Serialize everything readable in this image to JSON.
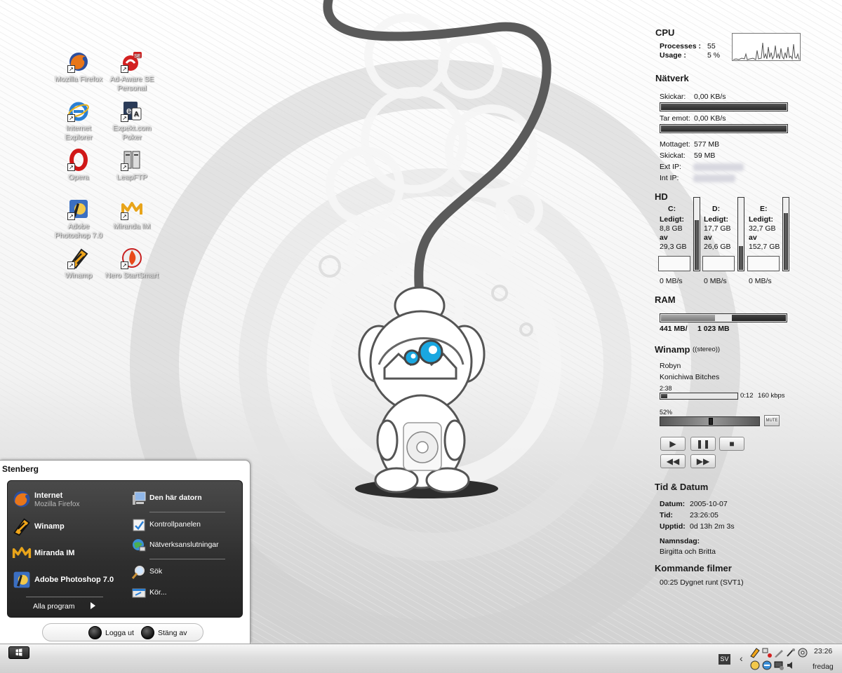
{
  "desktop": {
    "icons": [
      {
        "label": "Mozilla Firefox",
        "icon": "firefox-icon"
      },
      {
        "label": "Ad-Aware SE Personal",
        "icon": "adaware-icon"
      },
      {
        "label": "Internet Explorer",
        "icon": "internet-explorer-icon"
      },
      {
        "label": "Expekt.com Poker",
        "icon": "expekt-poker-icon"
      },
      {
        "label": "Opera",
        "icon": "opera-icon"
      },
      {
        "label": "LeapFTP",
        "icon": "leapftp-icon"
      },
      {
        "label": "Adobe Photoshop 7.0",
        "icon": "photoshop-icon"
      },
      {
        "label": "Miranda IM",
        "icon": "miranda-icon"
      },
      {
        "label": "Winamp",
        "icon": "winamp-icon"
      },
      {
        "label": "Nero StartSmart",
        "icon": "nero-icon"
      }
    ]
  },
  "widgets": {
    "cpu": {
      "title": "CPU",
      "processes_label": "Processes :",
      "processes_value": "55",
      "usage_label": "Usage :",
      "usage_value": "5 %"
    },
    "network": {
      "title": "Nätverk",
      "send_label": "Skickar:",
      "send_value": "0,00 KB/s",
      "recv_label": "Tar emot:",
      "recv_value": "0,00 KB/s",
      "received_label": "Mottaget:",
      "received_value": "577 MB",
      "sent_label": "Skickat:",
      "sent_value": "59 MB",
      "ext_ip_label": "Ext IP:",
      "int_ip_label": "Int IP:"
    },
    "hd": {
      "title": "HD",
      "drives": [
        {
          "name": "C:",
          "free_label": "Ledigt:",
          "free": "8,8 GB",
          "of_label": "av",
          "total": "29,3 GB",
          "speed": "0 MB/s",
          "used_fraction": 0.7
        },
        {
          "name": "D:",
          "free_label": "Ledigt:",
          "free": "17,7 GB",
          "of_label": "av",
          "total": "26,6 GB",
          "speed": "0 MB/s",
          "used_fraction": 0.33
        },
        {
          "name": "E:",
          "free_label": "Ledigt:",
          "free": "32,7 GB",
          "of_label": "av",
          "total": "152,7 GB",
          "speed": "0 MB/s",
          "used_fraction": 0.79
        }
      ]
    },
    "ram": {
      "title": "RAM",
      "used": "441 MB/",
      "total": "1 023 MB",
      "used_fraction": 0.43
    },
    "winamp": {
      "title": "Winamp",
      "mode": "((stereo))",
      "artist": "Robyn",
      "track": "Konichiwa Bitches",
      "duration": "2:38",
      "position": "0:12",
      "bitrate": "160 kbps",
      "progress_fraction": 0.08,
      "volume_label": "52%",
      "volume_fraction": 0.52,
      "mute_label": "MUTE"
    },
    "datetime": {
      "title": "Tid & Datum",
      "date_label": "Datum:",
      "date_value": "2005-10-07",
      "time_label": "Tid:",
      "time_value": "23:26:05",
      "uptime_label": "Upptid:",
      "uptime_value": "0d 13h 2m 3s",
      "nameday_label": "Namnsdag:",
      "nameday_value": "Birgitta och Britta"
    },
    "movies": {
      "title": "Kommande filmer",
      "item": "00:25 Dygnet runt (SVT1)"
    }
  },
  "start_menu": {
    "user": "Stenberg",
    "pinned": [
      {
        "label": "Internet",
        "sub": "Mozilla Firefox",
        "icon": "firefox-icon"
      },
      {
        "label": "Winamp",
        "sub": "",
        "icon": "winamp-icon"
      },
      {
        "label": "Miranda IM",
        "sub": "",
        "icon": "miranda-icon"
      },
      {
        "label": "Adobe Photoshop 7.0",
        "sub": "",
        "icon": "photoshop-icon"
      }
    ],
    "all_programs": "Alla program",
    "right": {
      "my_computer": "Den här datorn",
      "control_panel": "Kontrollpanelen",
      "network_connections": "Nätverksanslutningar",
      "search": "Sök",
      "run": "Kör..."
    },
    "logoff": "Logga ut",
    "shutdown": "Stäng av"
  },
  "taskbar": {
    "language": "SV",
    "time": "23:26",
    "day": "fredag"
  },
  "colors": {
    "panel_dark": "#2e2e2e",
    "accent_blue": "#1aa7e0",
    "bar_fill": "#3a3a3a"
  }
}
